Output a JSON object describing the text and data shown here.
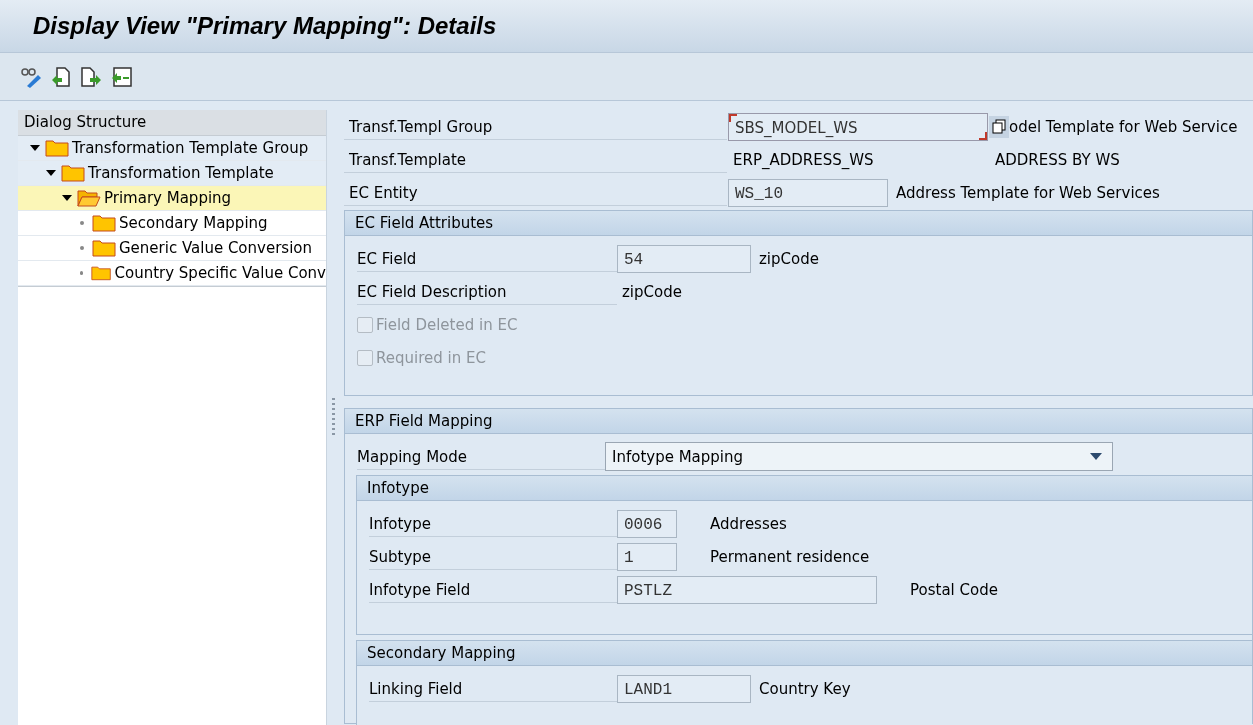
{
  "window": {
    "title": "Display View \"Primary Mapping\": Details"
  },
  "toolbar": [
    {
      "kind": "edit"
    },
    {
      "kind": "previous"
    },
    {
      "kind": "next"
    },
    {
      "kind": "select"
    }
  ],
  "dialog_structure": {
    "title": "Dialog Structure",
    "nodes": [
      {
        "label": "Transformation Template Group",
        "expanded": true,
        "selected": false,
        "children": [
          {
            "label": "Transformation Template",
            "expanded": true,
            "selected": false,
            "children": [
              {
                "label": "Primary Mapping",
                "expanded": true,
                "selected": true,
                "children": [
                  {
                    "label": "Secondary Mapping",
                    "selected": false
                  },
                  {
                    "label": "Generic Value Conversion",
                    "selected": false
                  },
                  {
                    "label": "Country Specific Value Conv",
                    "selected": false
                  }
                ]
              }
            ]
          }
        ]
      }
    ]
  },
  "header_fields": [
    {
      "label": "Transf.Templ Group",
      "kind": "field",
      "value": "SBS_MODEL_WS",
      "focused": true,
      "description": "odel Template for Web Service"
    },
    {
      "label": "Transf.Template",
      "kind": "text",
      "value": "ERP_ADDRESS_WS",
      "description": "ADDRESS BY WS"
    },
    {
      "label": "EC Entity",
      "kind": "field",
      "value": "WS_10",
      "focused": false,
      "description": "Address Template for Web Services"
    }
  ],
  "ec_field_attributes": {
    "title": "EC Field Attributes",
    "rows": [
      {
        "label": "EC Field",
        "kind": "field",
        "value": "54",
        "description": "zipCode"
      },
      {
        "label": "EC Field Description",
        "kind": "text",
        "value": "zipCode"
      },
      {
        "label": "Field Deleted in EC",
        "kind": "checkbox",
        "checked": false,
        "disabled": true
      },
      {
        "label": "Required in EC",
        "kind": "checkbox",
        "checked": false,
        "disabled": true
      }
    ]
  },
  "erp_field_mapping": {
    "title": "ERP Field Mapping",
    "mapping_mode": {
      "label": "Mapping Mode",
      "value": "Infotype Mapping"
    },
    "infotype": {
      "title": "Infotype",
      "rows": [
        {
          "label": "Infotype",
          "value": "0006",
          "description": "Addresses"
        },
        {
          "label": "Subtype",
          "value": "1",
          "description": "Permanent residence"
        },
        {
          "label": "Infotype Field",
          "value": "PSTLZ",
          "description": "Postal Code"
        }
      ]
    },
    "secondary_mapping": {
      "title": "Secondary Mapping",
      "rows": [
        {
          "label": "Linking Field",
          "value": "LAND1",
          "description": "Country Key"
        }
      ]
    }
  }
}
